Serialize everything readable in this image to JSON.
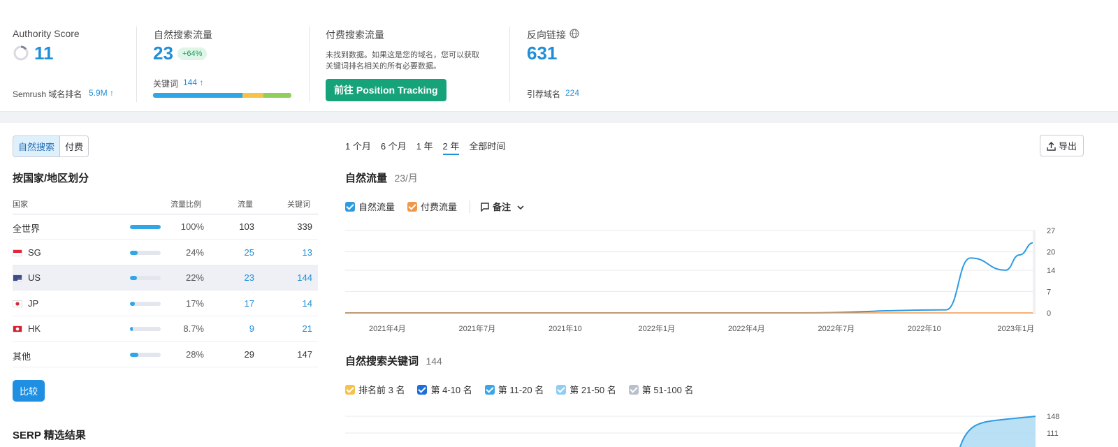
{
  "summary": {
    "authority": {
      "label": "Authority Score",
      "value": "11",
      "rank_label": "Semrush 域名排名",
      "rank_value": "5.9M ↑"
    },
    "organic": {
      "label": "自然搜索流量",
      "value": "23",
      "change": "+64%",
      "kw_label": "关键词",
      "kw_value": "144 ↑"
    },
    "paid": {
      "label": "付费搜索流量",
      "note_line1": "未找到数据。如果这是您的域名，您可以获取",
      "note_line2": "关键词排名相关的所有必要数据。",
      "cta": "前往 Position Tracking"
    },
    "backlinks": {
      "label": "反向链接",
      "value": "631",
      "ref_label": "引荐域名",
      "ref_value": "224"
    }
  },
  "toggle": {
    "organic": "自然搜索",
    "paid": "付费"
  },
  "country_section": {
    "title": "按国家/地区划分",
    "headers": {
      "country": "国家",
      "share": "流量比例",
      "traffic": "流量",
      "keywords": "关键词"
    },
    "rows": [
      {
        "name": "全世界",
        "share": "100%",
        "share_frac": 1.0,
        "traffic": "103",
        "keywords": "339",
        "flag": "",
        "linked": false
      },
      {
        "name": "SG",
        "share": "24%",
        "share_frac": 0.24,
        "traffic": "25",
        "keywords": "13",
        "flag": "sg",
        "linked": true
      },
      {
        "name": "US",
        "share": "22%",
        "share_frac": 0.22,
        "traffic": "23",
        "keywords": "144",
        "flag": "us",
        "linked": true
      },
      {
        "name": "JP",
        "share": "17%",
        "share_frac": 0.17,
        "traffic": "17",
        "keywords": "14",
        "flag": "jp",
        "linked": true
      },
      {
        "name": "HK",
        "share": "8.7%",
        "share_frac": 0.087,
        "traffic": "9",
        "keywords": "21",
        "flag": "hk",
        "linked": true
      },
      {
        "name": "其他",
        "share": "28%",
        "share_frac": 0.28,
        "traffic": "29",
        "keywords": "147",
        "flag": "",
        "linked": false
      }
    ],
    "compare_button": "比较"
  },
  "serp_title": "SERP 精选结果",
  "time_ranges": [
    "1 个月",
    "6 个月",
    "1 年",
    "2 年",
    "全部时间"
  ],
  "active_range": "2 年",
  "export_label": "导出",
  "traffic_chart": {
    "title": "自然流量",
    "subtitle": "23/月",
    "legend": [
      {
        "name": "自然流量",
        "color": "#2d9be2"
      },
      {
        "name": "付费流量",
        "color": "#f0974a"
      }
    ],
    "notes_label": "备注"
  },
  "keywords_chart": {
    "title": "自然搜索关键词",
    "subtitle": "144",
    "legend": [
      {
        "name": "排名前 3 名",
        "color": "#f5c24c"
      },
      {
        "name": "第 4-10 名",
        "color": "#1e6fd6"
      },
      {
        "name": "第 11-20 名",
        "color": "#3aa6e8"
      },
      {
        "name": "第 21-50 名",
        "color": "#8fcdf2"
      },
      {
        "name": "第 51-100 名",
        "color": "#b9c0cc"
      }
    ]
  },
  "chart_data": [
    {
      "type": "line",
      "title": "自然流量",
      "x": [
        "2021年4月",
        "2021年7月",
        "2021年10月",
        "2022年1月",
        "2022年4月",
        "2022年7月",
        "2022年10月",
        "2022年11月",
        "2022年12月",
        "2023年1月",
        "2023年2月"
      ],
      "x_tick_labels": [
        "2021年4月",
        "2021年7月",
        "2021年10",
        "2022年1月",
        "2022年4月",
        "2022年7月",
        "2022年10",
        "2023年1月"
      ],
      "y_ticks": [
        0,
        7,
        14,
        20,
        27
      ],
      "ylim": [
        0,
        27
      ],
      "series": [
        {
          "name": "自然流量",
          "color": "#2d9be2",
          "values": [
            0,
            0,
            0,
            0,
            0,
            0,
            1,
            18,
            14,
            19,
            23
          ]
        },
        {
          "name": "付费流量",
          "color": "#f0974a",
          "values": [
            0,
            0,
            0,
            0,
            0,
            0,
            0,
            0,
            0,
            0,
            0
          ]
        }
      ]
    },
    {
      "type": "area",
      "title": "自然搜索关键词",
      "y_ticks": [
        111,
        148
      ],
      "series": [
        {
          "name": "第 51-100 名",
          "values_visible_end": [
            140,
            148
          ]
        }
      ]
    }
  ]
}
